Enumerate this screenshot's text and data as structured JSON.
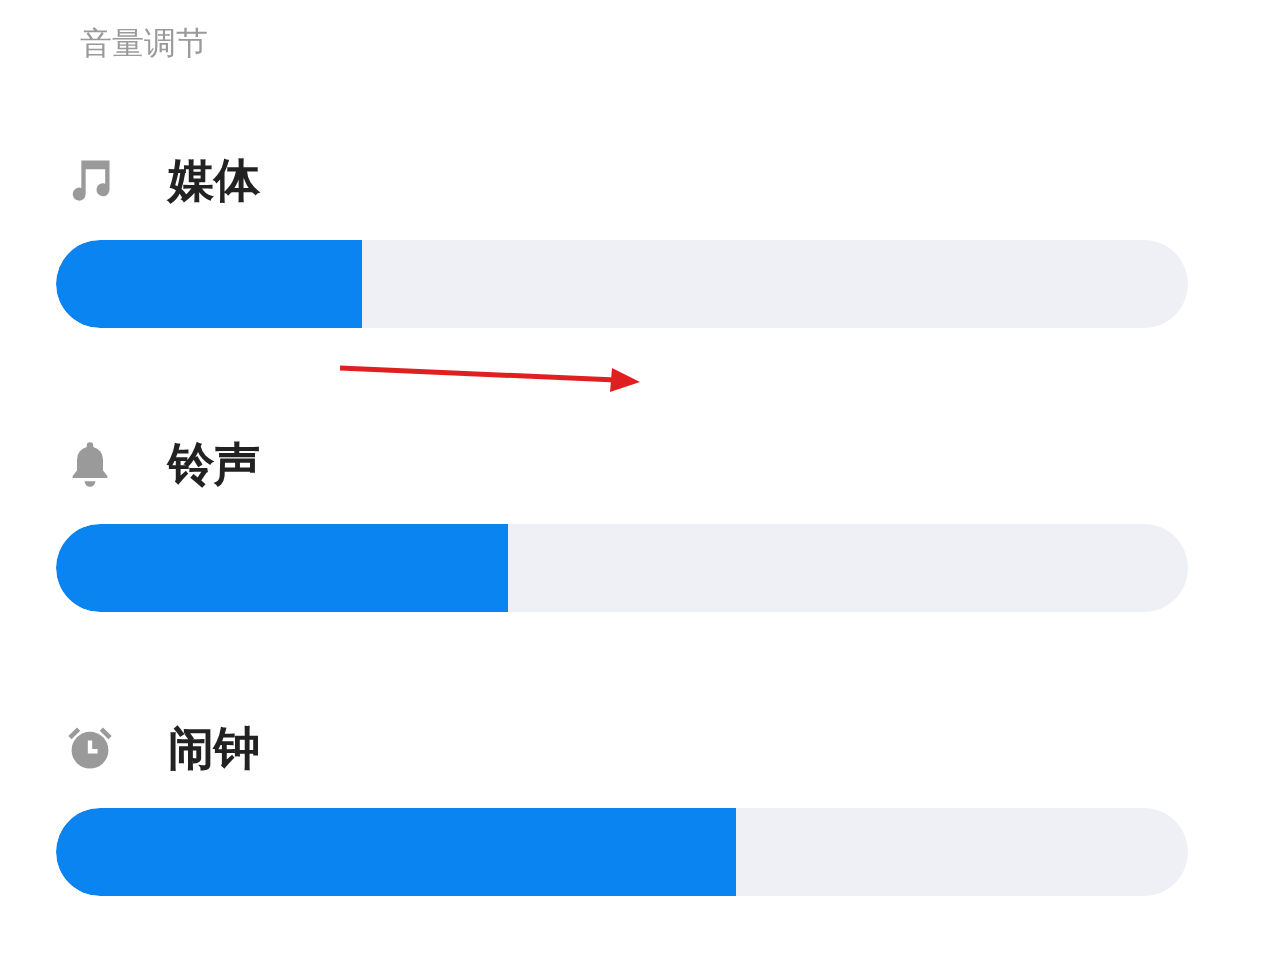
{
  "header": {
    "title": "音量调节"
  },
  "channels": [
    {
      "kind": "music",
      "name": "媒体",
      "level": 0.27
    },
    {
      "kind": "bell",
      "name": "铃声",
      "level": 0.4
    },
    {
      "kind": "alarm",
      "name": "闹钟",
      "level": 0.6
    }
  ]
}
